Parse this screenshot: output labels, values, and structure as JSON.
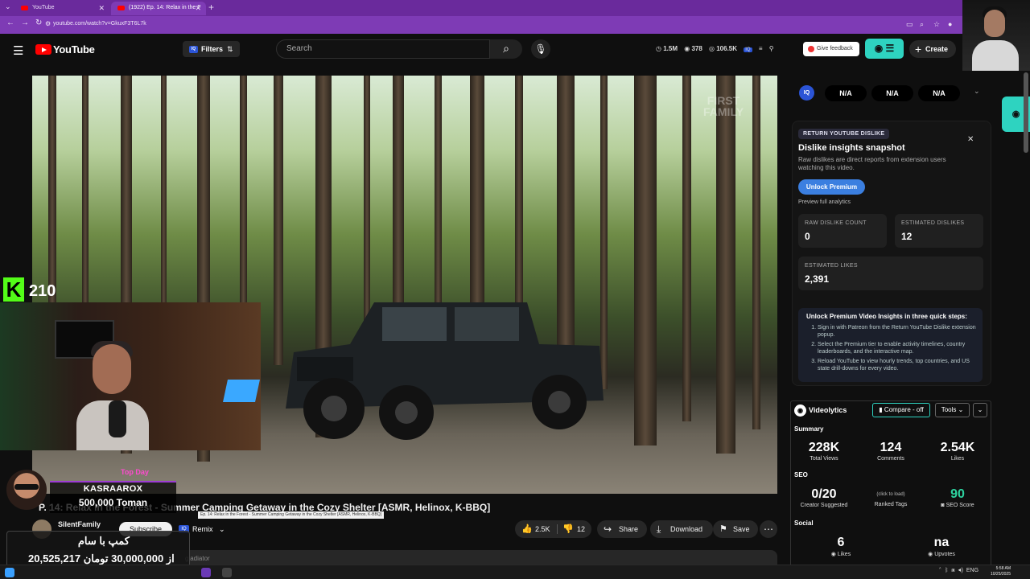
{
  "browser": {
    "tabs": [
      {
        "label": "YouTube"
      },
      {
        "label": "(1922) Ep. 14: Relax in the F"
      }
    ],
    "new_tab": "+",
    "url": "youtube.com/watch?v=GkuxF3T6L7k"
  },
  "header": {
    "logo_text": "YouTube",
    "filters_label": "Filters",
    "search_placeholder": "Search",
    "stats": {
      "views": "1.5M",
      "comments": "378",
      "likes": "106.5K"
    },
    "feedback_label": "Give feedback",
    "create_label": "Create"
  },
  "video": {
    "watermark": "FIRST\nFAMILY",
    "title": "Ep. 14: Relax in the Forest - Summer Camping Getaway in the Cozy Shelter [ASMR, Helinox, K-BBQ]",
    "visible_title": "P. 14: Relax in the Forest - Summer Camping Getaway in the Cozy Shelter [ASMR, Helinox, K-BBQ]",
    "tooltip": "Ep. 14: Relax in the Forest - Summer Camping Getaway in the Cozy Shelter [ASMR, Helinox, K-BBQ]",
    "channel": "SilentFamily",
    "subscribe_label": "Subscribe",
    "remix_label": "Remix",
    "like_count": "2.5K",
    "dislike_count": "12",
    "share_label": "Share",
    "download_label": "Download",
    "save_label": "Save",
    "more_label": "⋯",
    "desc_peek": "gladiator"
  },
  "stream_overlay": {
    "kick_letter": "K",
    "viewer_count": "210",
    "donation_tag": "Top Day",
    "donor_name": "KASRAAROX",
    "donation_amount": "500,000 Toman",
    "goal_title": "کمپ با سام",
    "goal_progress": "20,525,217 از 30,000,000 تومان"
  },
  "iq_bar": {
    "badge": "IQ",
    "values": [
      "N/A",
      "N/A",
      "N/A"
    ]
  },
  "ryd": {
    "tag": "RETURN YOUTUBE DISLIKE",
    "title": "Dislike insights snapshot",
    "description": "Raw dislikes are direct reports from extension users watching this video.",
    "unlock_label": "Unlock Premium",
    "preview_label": "Preview full analytics",
    "cards": [
      {
        "label": "RAW DISLIKE COUNT",
        "value": "0"
      },
      {
        "label": "ESTIMATED DISLIKES",
        "value": "12"
      },
      {
        "label": "ESTIMATED LIKES",
        "value": "2,391"
      }
    ],
    "steps_title": "Unlock Premium Video Insights in three quick steps:",
    "steps": [
      "Sign in with Patreon from the Return YouTube Dislike extension popup.",
      "Select the Premium tier to enable activity timelines, country leaderboards, and the interactive map.",
      "Reload YouTube to view hourly trends, top countries, and US state drill-downs for every video."
    ]
  },
  "videolytics": {
    "name": "Videolytics",
    "compare_label": "Compare - off",
    "tools_label": "Tools",
    "summary_label": "Summary",
    "summary": [
      {
        "value": "228K",
        "label": "Total Views"
      },
      {
        "value": "124",
        "label": "Comments"
      },
      {
        "value": "2.54K",
        "label": "Likes"
      }
    ],
    "seo_label": "SEO",
    "seo": [
      {
        "value": "0/20",
        "label": "Creator Suggested"
      },
      {
        "value": "(click to load)",
        "label": "Ranked Tags"
      },
      {
        "value": "90",
        "label": "SEO Score"
      }
    ],
    "social_label": "Social",
    "social": [
      {
        "value": "6",
        "label": "Likes"
      },
      {
        "value": "na",
        "label": "Upvotes"
      }
    ]
  },
  "taskbar": {
    "tray_lang": "ENG",
    "time": "5:58 AM",
    "date": "10/25/2025"
  },
  "colors": {
    "youtube_red": "#ff0000",
    "accent_teal": "#2ed3c0",
    "browser_purple": "#7e3bb5",
    "kick_green": "#53fc18"
  }
}
